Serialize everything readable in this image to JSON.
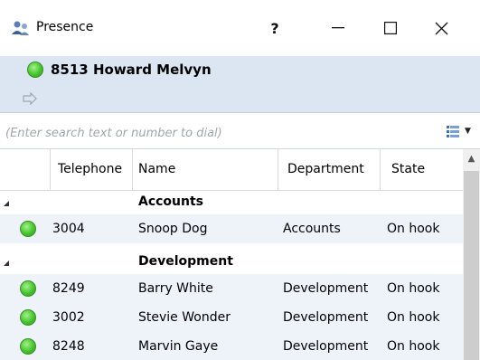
{
  "window": {
    "title": "Presence",
    "help_label": "?",
    "minimize_label": "—",
    "maximize_label": "☐",
    "close_label": "✕"
  },
  "user": {
    "display": "8513 Howard Melvyn",
    "status_color": "#46c42e"
  },
  "search": {
    "placeholder": "(Enter search text or number to dial)",
    "value": ""
  },
  "grid": {
    "columns": [
      "Telephone",
      "Name",
      "Department",
      "State"
    ],
    "groups": [
      {
        "label": "Accounts",
        "rows": [
          {
            "telephone": "3004",
            "name": "Snoop Dog",
            "department": "Accounts",
            "state": "On hook"
          }
        ]
      },
      {
        "label": "Development",
        "rows": [
          {
            "telephone": "8249",
            "name": "Barry White",
            "department": "Development",
            "state": "On hook"
          },
          {
            "telephone": "3002",
            "name": "Stevie Wonder",
            "department": "Development",
            "state": "On hook"
          },
          {
            "telephone": "8248",
            "name": "Marvin Gaye",
            "department": "Development",
            "state": "On hook"
          }
        ]
      }
    ]
  },
  "icons": {
    "app": "users-phone-icon",
    "transfer": "transfer-arrow-icon",
    "columns": "column-chooser-icon"
  },
  "colors": {
    "header_band": "#dce6f2",
    "row_alt": "#eef3f9",
    "status_green": "#46c42e"
  }
}
